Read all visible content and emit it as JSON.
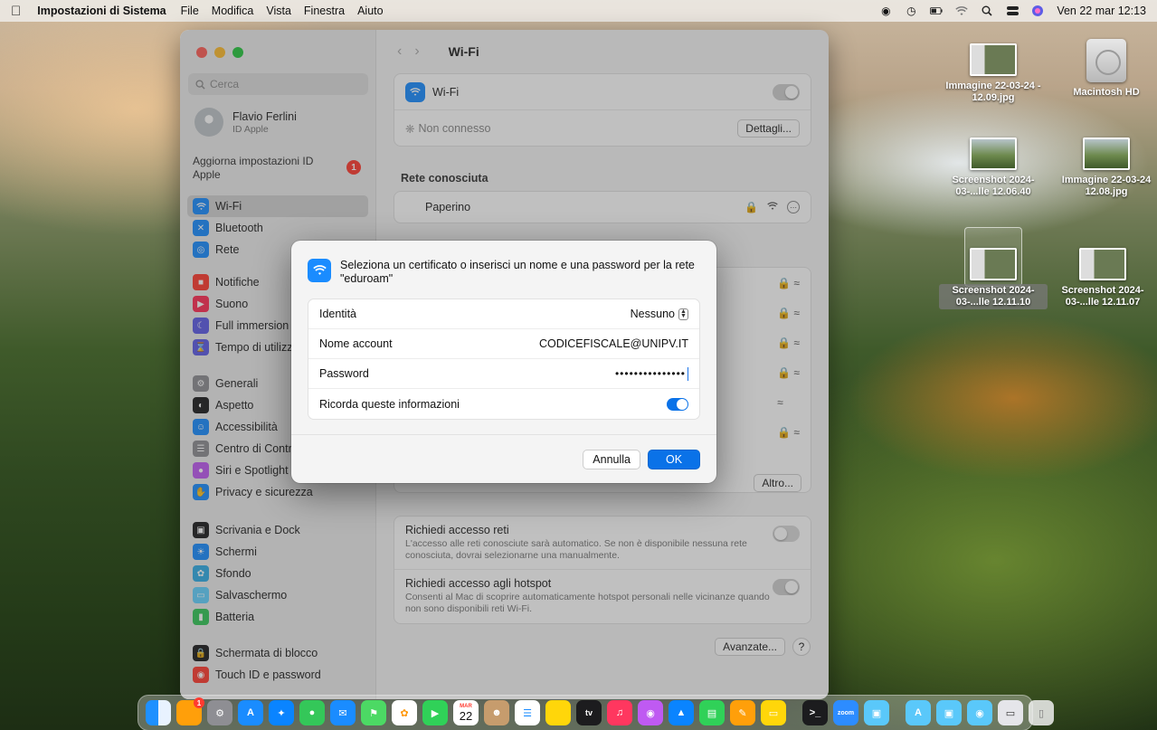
{
  "menubar": {
    "app_name": "Impostazioni di Sistema",
    "menus": [
      "File",
      "Modifica",
      "Vista",
      "Finestra",
      "Aiuto"
    ],
    "clock": "Ven 22 mar 12:13"
  },
  "desktop": {
    "icons": [
      {
        "label": "Immagine 22-03-24 - 12.09.jpg"
      },
      {
        "label": "Macintosh HD"
      },
      {
        "label": "Screenshot 2024-03-...lle 12.06.40"
      },
      {
        "label": "Immagine 22-03-24 12.08.jpg"
      },
      {
        "label": "Screenshot 2024-03-...lle 12.11.10"
      },
      {
        "label": "Screenshot 2024-03-...lle 12.11.07"
      }
    ]
  },
  "sidebar": {
    "search_placeholder": "Cerca",
    "profile_name": "Flavio Ferlini",
    "profile_sub": "ID Apple",
    "update_text": "Aggiorna impostazioni ID Apple",
    "update_badge": "1",
    "items": [
      {
        "label": "Wi-Fi",
        "color": "#1a8cff"
      },
      {
        "label": "Bluetooth",
        "color": "#1a8cff"
      },
      {
        "label": "Rete",
        "color": "#1a8cff"
      },
      {
        "label": "Notifiche",
        "color": "#ff3b30"
      },
      {
        "label": "Suono",
        "color": "#ff2d55"
      },
      {
        "label": "Full immersion",
        "color": "#5e5ce6"
      },
      {
        "label": "Tempo di utilizzo",
        "color": "#5e5ce6"
      },
      {
        "label": "Generali",
        "color": "#8e8e93"
      },
      {
        "label": "Aspetto",
        "color": "#1c1c1e"
      },
      {
        "label": "Accessibilità",
        "color": "#1a8cff"
      },
      {
        "label": "Centro di Controllo",
        "color": "#8e8e93"
      },
      {
        "label": "Siri e Spotlight",
        "color": "#bf5af2"
      },
      {
        "label": "Privacy e sicurezza",
        "color": "#1a8cff"
      },
      {
        "label": "Scrivania e Dock",
        "color": "#1c1c1e"
      },
      {
        "label": "Schermi",
        "color": "#1a8cff"
      },
      {
        "label": "Sfondo",
        "color": "#32ade6"
      },
      {
        "label": "Salvaschermo",
        "color": "#64d2ff"
      },
      {
        "label": "Batteria",
        "color": "#34c759"
      },
      {
        "label": "Schermata di blocco",
        "color": "#1c1c1e"
      },
      {
        "label": "Touch ID e password",
        "color": "#ff3b30"
      }
    ]
  },
  "content": {
    "title": "Wi-Fi",
    "wifi_label": "Wi-Fi",
    "status": "Non connesso",
    "details_button": "Dettagli...",
    "known_title": "Rete conosciuta",
    "known_network": "Paperino",
    "other_button": "Altro...",
    "ask_networks_title": "Richiedi accesso reti",
    "ask_networks_desc": "L'accesso alle reti conosciute sarà automatico. Se non è disponibile nessuna rete conosciuta, dovrai selezionarne una manualmente.",
    "ask_hotspot_title": "Richiedi accesso agli hotspot",
    "ask_hotspot_desc": "Consenti al Mac di scoprire automaticamente hotspot personali nelle vicinanze quando non sono disponibili reti Wi-Fi.",
    "advanced_button": "Avanzate...",
    "help_button": "?"
  },
  "dialog": {
    "message": "Seleziona un certificato o inserisci un nome e una password per la rete \"eduroam\"",
    "identity_label": "Identità",
    "identity_value": "Nessuno",
    "account_label": "Nome account",
    "account_value": "CODICEFISCALE@UNIPV.IT",
    "password_label": "Password",
    "password_value": "•••••••••••••••",
    "remember_label": "Ricorda queste informazioni",
    "cancel_button": "Annulla",
    "ok_button": "OK"
  },
  "dock": {
    "calendar_month": "MAR",
    "calendar_day": "22",
    "tv_label": "tv",
    "zoom_label": "zoom",
    "badge": "1"
  }
}
